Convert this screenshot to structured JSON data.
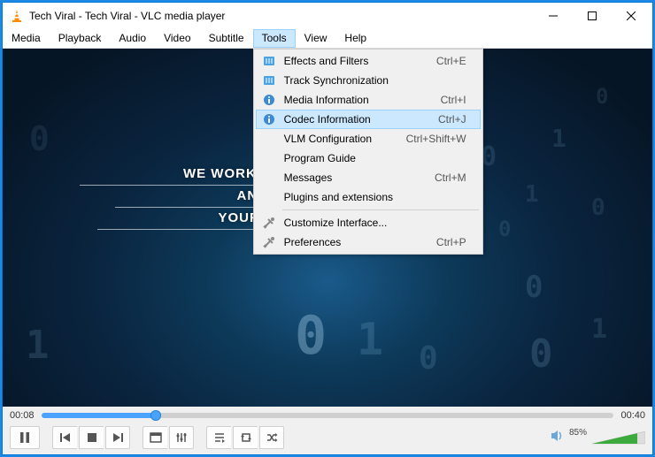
{
  "window": {
    "title": "Tech Viral - Tech Viral - VLC media player"
  },
  "menubar": [
    "Media",
    "Playback",
    "Audio",
    "Video",
    "Subtitle",
    "Tools",
    "View",
    "Help"
  ],
  "active_menu": "Tools",
  "dropdown": {
    "items": [
      {
        "icon": "equalizer",
        "label": "Effects and Filters",
        "shortcut": "Ctrl+E"
      },
      {
        "icon": "equalizer",
        "label": "Track Synchronization",
        "shortcut": ""
      },
      {
        "icon": "info",
        "label": "Media Information",
        "shortcut": "Ctrl+I"
      },
      {
        "icon": "info",
        "label": "Codec Information",
        "shortcut": "Ctrl+J",
        "highlight": true
      },
      {
        "icon": "",
        "label": "VLM Configuration",
        "shortcut": "Ctrl+Shift+W"
      },
      {
        "icon": "",
        "label": "Program Guide",
        "shortcut": ""
      },
      {
        "icon": "",
        "label": "Messages",
        "shortcut": "Ctrl+M"
      },
      {
        "icon": "",
        "label": "Plugins and extensions",
        "shortcut": ""
      },
      {
        "sep": true
      },
      {
        "icon": "tools",
        "label": "Customize Interface...",
        "shortcut": ""
      },
      {
        "icon": "tools",
        "label": "Preferences",
        "shortcut": "Ctrl+P"
      }
    ]
  },
  "video_overlay": {
    "line1": "WE WORK HARD TO",
    "line2": "AND BEST O",
    "line3": "YOUR HUNGER"
  },
  "playback": {
    "elapsed": "00:08",
    "total": "00:40",
    "progress_percent": 20,
    "volume_percent": 85
  }
}
